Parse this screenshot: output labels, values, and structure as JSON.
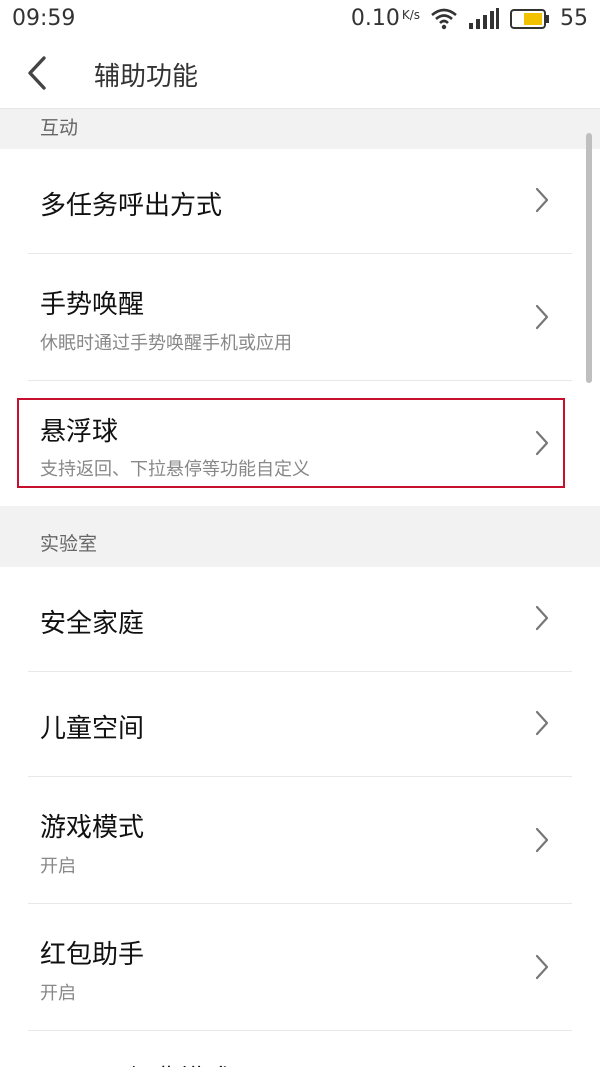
{
  "status_bar": {
    "time": "09:59",
    "speed": "0.10",
    "speed_unit": "K/s",
    "battery": "55"
  },
  "header": {
    "title": "辅助功能"
  },
  "sections": [
    {
      "title": "互动",
      "items": [
        {
          "label": "多任务呼出方式",
          "sub": ""
        },
        {
          "label": "手势唤醒",
          "sub": "休眠时通过手势唤醒手机或应用"
        },
        {
          "label": "悬浮球",
          "sub": "支持返回、下拉悬停等功能自定义"
        }
      ]
    },
    {
      "title": "实验室",
      "items": [
        {
          "label": "安全家庭",
          "sub": ""
        },
        {
          "label": "儿童空间",
          "sub": ""
        },
        {
          "label": "游戏模式",
          "sub": "开启"
        },
        {
          "label": "红包助手",
          "sub": "开启"
        },
        {
          "label": "Flyme 经典模式",
          "sub": ""
        }
      ]
    }
  ],
  "colors": {
    "highlight": "#c8102e",
    "battery_fill": "#f2c200"
  }
}
